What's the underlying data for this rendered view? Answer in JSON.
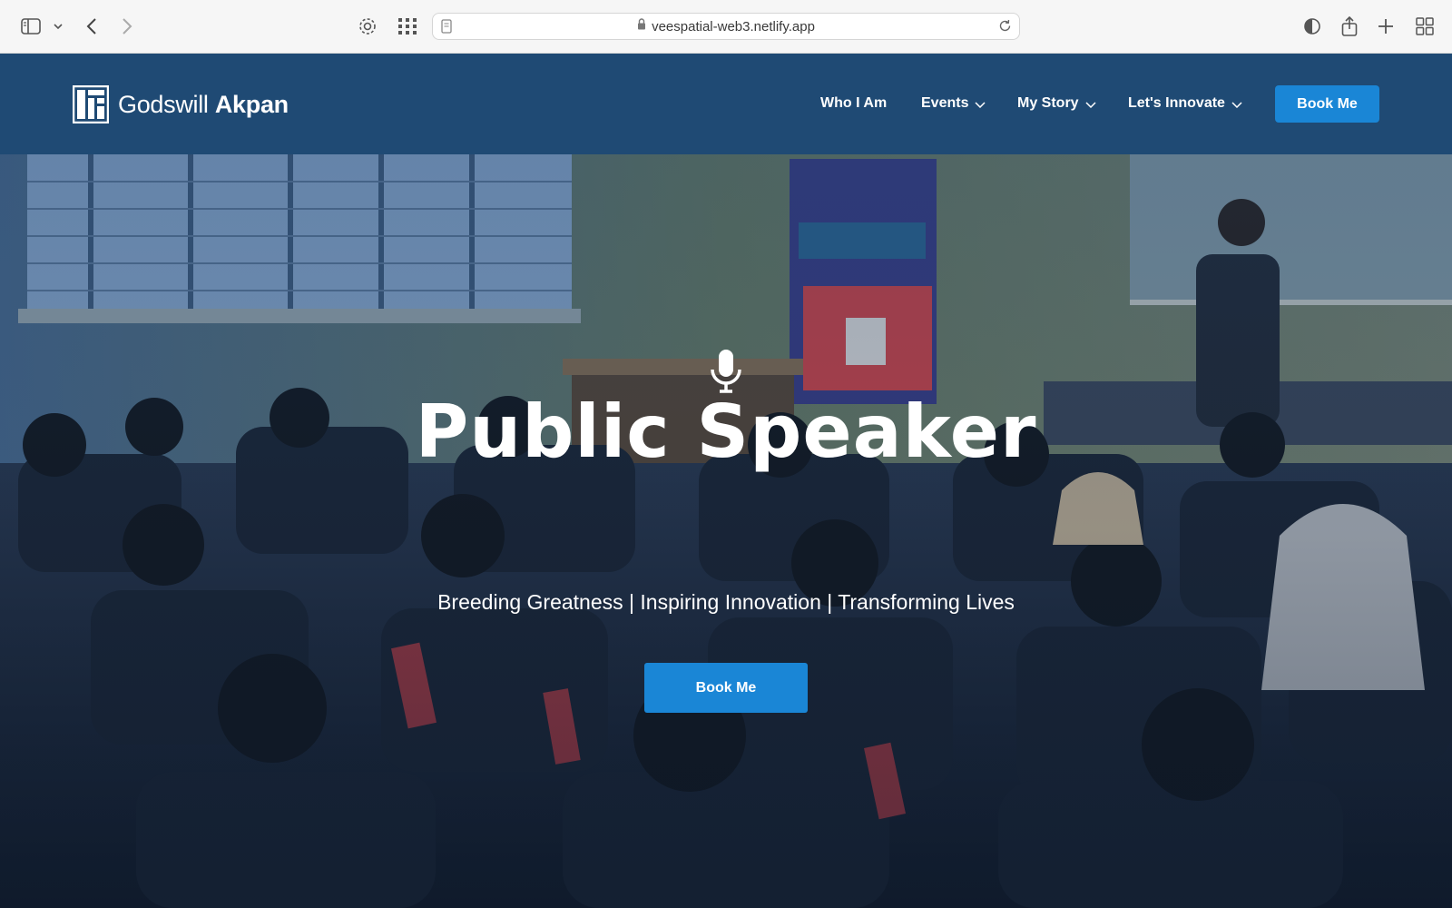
{
  "browser": {
    "url": "veespatial-web3.netlify.app",
    "icons": [
      "sidebar-icon",
      "chevron-down-icon",
      "back-icon",
      "forward-icon",
      "gear-icon",
      "grid-icon",
      "page-icon",
      "lock-icon",
      "reload-icon",
      "shield-icon",
      "share-icon",
      "plus-icon",
      "tabs-overview-icon"
    ]
  },
  "header": {
    "logo_first": "Godswill",
    "logo_last": "Akpan",
    "nav": [
      {
        "label": "Who I Am",
        "dropdown": false
      },
      {
        "label": "Events",
        "dropdown": true
      },
      {
        "label": "My Story",
        "dropdown": true
      },
      {
        "label": "Let's Innovate",
        "dropdown": true
      }
    ],
    "book_label": "Book Me"
  },
  "hero": {
    "icon": "microphone-icon",
    "title": "Public Speaker",
    "subtitle": "Breeding Greatness | Inspiring Innovation | Transforming Lives",
    "book_label": "Book Me"
  },
  "colors": {
    "header_bg": "#1f4a74",
    "accent": "#1a86d6",
    "text": "#ffffff"
  }
}
